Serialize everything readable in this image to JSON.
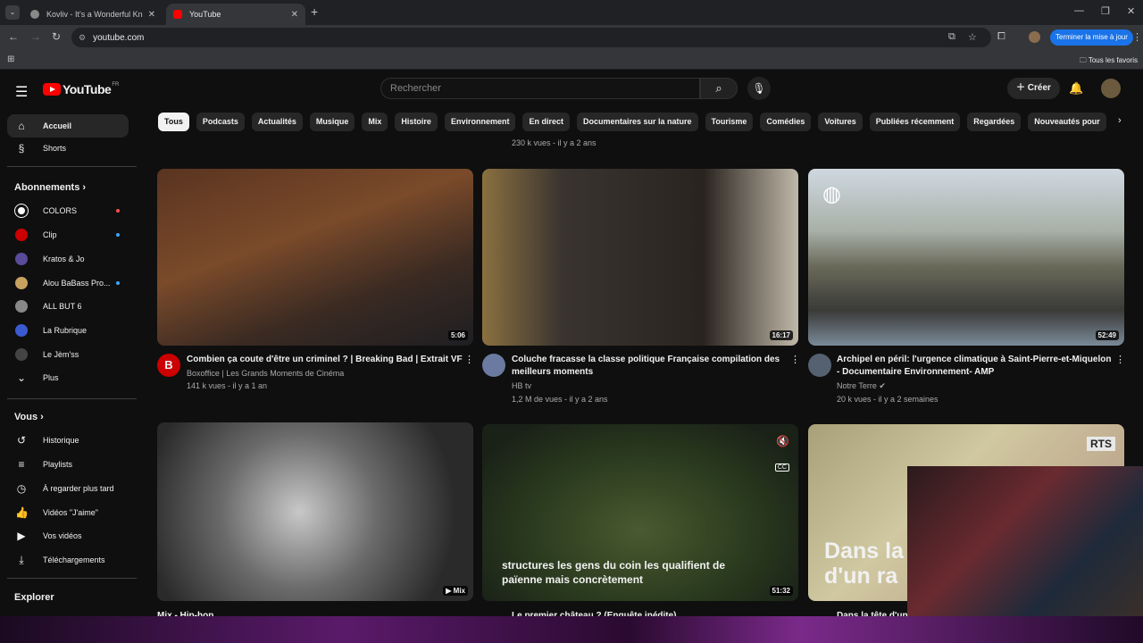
{
  "browser": {
    "tabs": [
      {
        "title": "Kovliv - It's a Wonderful Knife (",
        "active": false
      },
      {
        "title": "YouTube",
        "active": true
      }
    ],
    "url": "youtube.com",
    "update_button": "Terminer la mise à jour",
    "bookmarks_all": "Tous les favoris"
  },
  "header": {
    "logo": "YouTube",
    "logo_region": "FR",
    "search_placeholder": "Rechercher",
    "create_label": "Créer"
  },
  "sidebar": {
    "main": [
      {
        "label": "Accueil",
        "icon": "home-icon",
        "active": true
      },
      {
        "label": "Shorts",
        "icon": "shorts-icon",
        "active": false
      }
    ],
    "subscriptions_title": "Abonnements",
    "subscriptions": [
      {
        "label": "COLORS",
        "color": "#ffffff",
        "badge": "live"
      },
      {
        "label": "Clip",
        "color": "#cc0000",
        "badge": "new"
      },
      {
        "label": "Kratos & Jo",
        "color": "#5a4a9a",
        "badge": null
      },
      {
        "label": "Alou BaBass Pro...",
        "color": "#c8a060",
        "badge": "new"
      },
      {
        "label": "ALL BUT 6",
        "color": "#888888",
        "badge": null
      },
      {
        "label": "La Rubrique",
        "color": "#3a5ad0",
        "badge": null
      },
      {
        "label": "Le Jèm'ss",
        "color": "#444444",
        "badge": null
      }
    ],
    "more_label": "Plus",
    "you_title": "Vous",
    "you_items": [
      {
        "label": "Historique",
        "icon": "history-icon"
      },
      {
        "label": "Playlists",
        "icon": "playlist-icon"
      },
      {
        "label": "À regarder plus tard",
        "icon": "clock-icon"
      },
      {
        "label": "Vidéos \"J'aime\"",
        "icon": "thumb-up-icon"
      },
      {
        "label": "Vos vidéos",
        "icon": "video-icon"
      },
      {
        "label": "Téléchargements",
        "icon": "download-icon"
      }
    ],
    "explore_title": "Explorer"
  },
  "chips": [
    "Tous",
    "Podcasts",
    "Actualités",
    "Musique",
    "Mix",
    "Histoire",
    "Environnement",
    "En direct",
    "Documentaires sur la nature",
    "Tourisme",
    "Comédies",
    "Voitures",
    "Publiées récemment",
    "Regardées",
    "Nouveautés pour"
  ],
  "leftover_meta": "230 k vues - il y a 2 ans",
  "videos": [
    {
      "title": "Combien ça coute d'être un criminel ? | Breaking Bad | Extrait VF",
      "channel": "Boxoffice | Les Grands Moments de Cinéma",
      "meta": "141 k vues - il y a 1 an",
      "duration": "5:06",
      "avatar_letter": "B",
      "avatar_color": "#cc0000"
    },
    {
      "title": "Coluche fracasse la classe politique Française compilation des meilleurs moments",
      "channel": "HB tv",
      "meta": "1,2 M de vues - il y a 2 ans",
      "duration": "16:17",
      "avatar_letter": "",
      "avatar_color": "#6a7aa0"
    },
    {
      "title": "Archipel en péril: l'urgence climatique à Saint-Pierre-et-Miquelon - Documentaire Environnement- AMP",
      "channel": "Notre Terre",
      "meta": "20 k vues - il y a 2 semaines",
      "duration": "52:49",
      "avatar_letter": "",
      "avatar_color": "#556070"
    },
    {
      "title": "Mix - Hip-hop",
      "duration": "Mix"
    },
    {
      "title": "Le premier château ? (Enquête inédite)",
      "duration": "51:32",
      "caption": "structures les gens du coin les qualifient de païenne mais concrètement"
    },
    {
      "title": "Dans la tête d'un",
      "overlay": "Dans la d'un ra",
      "badge": "RTS"
    }
  ]
}
